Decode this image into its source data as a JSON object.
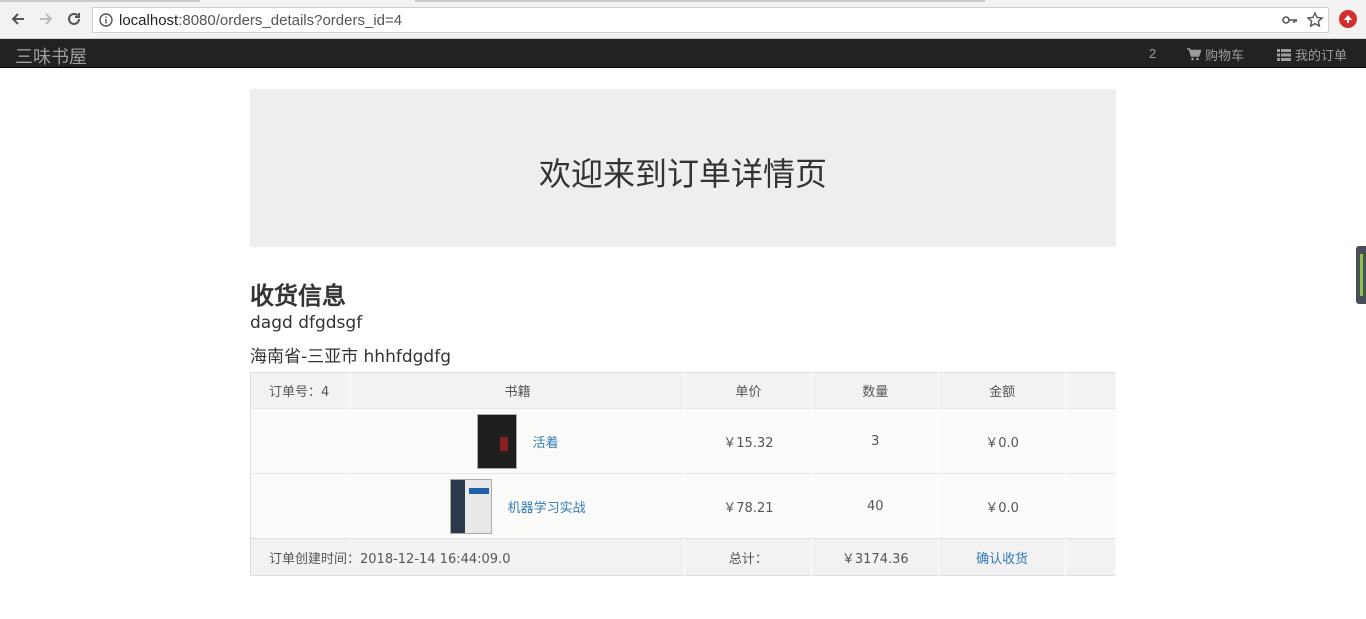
{
  "browser": {
    "url_host": "localhost",
    "url_rest": ":8080/orders_details?orders_id=4"
  },
  "navbar": {
    "brand": "三味书屋",
    "cart_count": "2",
    "cart_label": "购物车",
    "orders_label": "我的订单"
  },
  "jumbotron": {
    "title": "欢迎来到订单详情页"
  },
  "shipping": {
    "heading": "收货信息",
    "name_line": "dagd dfgdsgf",
    "address_line": "海南省-三亚市 hhhfdgdfg"
  },
  "order": {
    "header": {
      "order_no_label": "订单号：4",
      "book_col": "书籍",
      "price_col": "单价",
      "qty_col": "数量",
      "amount_col": "金额"
    },
    "items": [
      {
        "title": "活着",
        "price": "￥15.32",
        "qty": "3",
        "amount": "￥0.0"
      },
      {
        "title": "机器学习实战",
        "price": "￥78.21",
        "qty": "40",
        "amount": "￥0.0"
      }
    ],
    "footer": {
      "created": "订单创建时间：2018-12-14 16:44:09.0",
      "total_label": "总计：",
      "total_value": "￥3174.36",
      "confirm_label": "确认收货"
    }
  },
  "icons": {
    "back": "arrow-left-icon",
    "forward": "arrow-right-icon",
    "reload": "reload-icon",
    "info": "info-icon",
    "key": "key-icon",
    "star": "star-icon",
    "extension": "extension-icon",
    "cart": "cart-icon",
    "list": "list-icon"
  }
}
